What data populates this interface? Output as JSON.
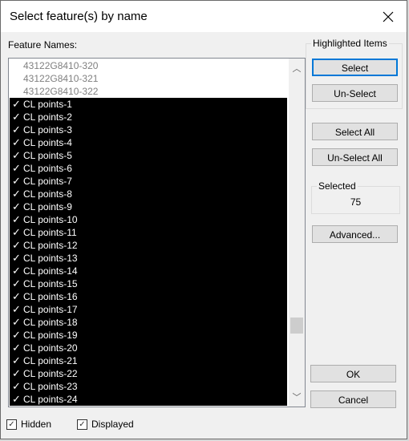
{
  "window": {
    "title": "Select feature(s) by name",
    "close_icon": "close-icon"
  },
  "list": {
    "label": "Feature Names:",
    "unselected_items": [
      "43122G8410-320",
      "43122G8410-321",
      "43122G8410-322"
    ],
    "selected_items": [
      "CL points-1",
      "CL points-2",
      "CL points-3",
      "CL points-4",
      "CL points-5",
      "CL points-6",
      "CL points-7",
      "CL points-8",
      "CL points-9",
      "CL points-10",
      "CL points-11",
      "CL points-12",
      "CL points-13",
      "CL points-14",
      "CL points-15",
      "CL points-16",
      "CL points-17",
      "CL points-18",
      "CL points-19",
      "CL points-20",
      "CL points-21",
      "CL points-22",
      "CL points-23",
      "CL points-24"
    ],
    "check_glyph": "✓"
  },
  "highlighted": {
    "label": "Highlighted Items",
    "select": "Select",
    "unselect": "Un-Select"
  },
  "buttons": {
    "select_all": "Select All",
    "unselect_all": "Un-Select All",
    "advanced": "Advanced...",
    "ok": "OK",
    "cancel": "Cancel"
  },
  "selected": {
    "label": "Selected",
    "count": "75"
  },
  "filters": {
    "hidden": {
      "label": "Hidden",
      "checked": true
    },
    "displayed": {
      "label": "Displayed",
      "checked": true
    }
  }
}
